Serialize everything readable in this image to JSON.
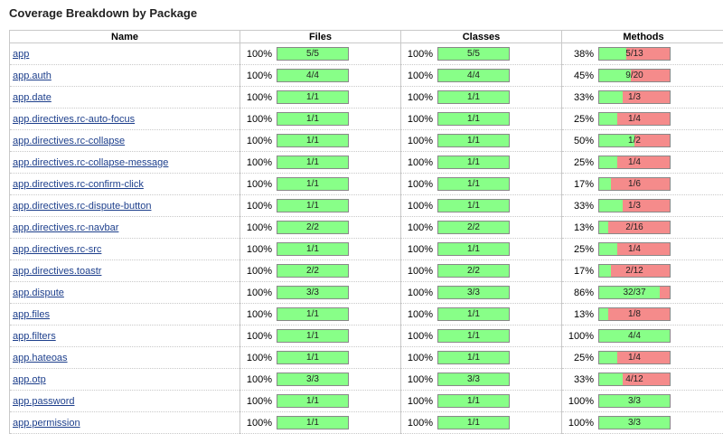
{
  "page": {
    "title": "Coverage Breakdown by Package"
  },
  "columns": {
    "name": "Name",
    "files": "Files",
    "classes": "Classes",
    "methods": "Methods"
  },
  "rows": [
    {
      "name": "app",
      "files": {
        "pct": "100%",
        "label": "5/5",
        "fill": 1
      },
      "classes": {
        "pct": "100%",
        "label": "5/5",
        "fill": 1
      },
      "methods": {
        "pct": "38%",
        "label": "5/13",
        "fill": 0.38
      }
    },
    {
      "name": "app.auth",
      "files": {
        "pct": "100%",
        "label": "4/4",
        "fill": 1
      },
      "classes": {
        "pct": "100%",
        "label": "4/4",
        "fill": 1
      },
      "methods": {
        "pct": "45%",
        "label": "9/20",
        "fill": 0.45
      }
    },
    {
      "name": "app.date",
      "files": {
        "pct": "100%",
        "label": "1/1",
        "fill": 1
      },
      "classes": {
        "pct": "100%",
        "label": "1/1",
        "fill": 1
      },
      "methods": {
        "pct": "33%",
        "label": "1/3",
        "fill": 0.33
      }
    },
    {
      "name": "app.directives.rc-auto-focus",
      "files": {
        "pct": "100%",
        "label": "1/1",
        "fill": 1
      },
      "classes": {
        "pct": "100%",
        "label": "1/1",
        "fill": 1
      },
      "methods": {
        "pct": "25%",
        "label": "1/4",
        "fill": 0.25
      }
    },
    {
      "name": "app.directives.rc-collapse",
      "files": {
        "pct": "100%",
        "label": "1/1",
        "fill": 1
      },
      "classes": {
        "pct": "100%",
        "label": "1/1",
        "fill": 1
      },
      "methods": {
        "pct": "50%",
        "label": "1/2",
        "fill": 0.5
      }
    },
    {
      "name": "app.directives.rc-collapse-message",
      "files": {
        "pct": "100%",
        "label": "1/1",
        "fill": 1
      },
      "classes": {
        "pct": "100%",
        "label": "1/1",
        "fill": 1
      },
      "methods": {
        "pct": "25%",
        "label": "1/4",
        "fill": 0.25
      }
    },
    {
      "name": "app.directives.rc-confirm-click",
      "files": {
        "pct": "100%",
        "label": "1/1",
        "fill": 1
      },
      "classes": {
        "pct": "100%",
        "label": "1/1",
        "fill": 1
      },
      "methods": {
        "pct": "17%",
        "label": "1/6",
        "fill": 0.17
      }
    },
    {
      "name": "app.directives.rc-dispute-button",
      "files": {
        "pct": "100%",
        "label": "1/1",
        "fill": 1
      },
      "classes": {
        "pct": "100%",
        "label": "1/1",
        "fill": 1
      },
      "methods": {
        "pct": "33%",
        "label": "1/3",
        "fill": 0.33
      }
    },
    {
      "name": "app.directives.rc-navbar",
      "files": {
        "pct": "100%",
        "label": "2/2",
        "fill": 1
      },
      "classes": {
        "pct": "100%",
        "label": "2/2",
        "fill": 1
      },
      "methods": {
        "pct": "13%",
        "label": "2/16",
        "fill": 0.13
      }
    },
    {
      "name": "app.directives.rc-src",
      "files": {
        "pct": "100%",
        "label": "1/1",
        "fill": 1
      },
      "classes": {
        "pct": "100%",
        "label": "1/1",
        "fill": 1
      },
      "methods": {
        "pct": "25%",
        "label": "1/4",
        "fill": 0.25
      }
    },
    {
      "name": "app.directives.toastr",
      "files": {
        "pct": "100%",
        "label": "2/2",
        "fill": 1
      },
      "classes": {
        "pct": "100%",
        "label": "2/2",
        "fill": 1
      },
      "methods": {
        "pct": "17%",
        "label": "2/12",
        "fill": 0.17
      }
    },
    {
      "name": "app.dispute",
      "files": {
        "pct": "100%",
        "label": "3/3",
        "fill": 1
      },
      "classes": {
        "pct": "100%",
        "label": "3/3",
        "fill": 1
      },
      "methods": {
        "pct": "86%",
        "label": "32/37",
        "fill": 0.86
      }
    },
    {
      "name": "app.files",
      "files": {
        "pct": "100%",
        "label": "1/1",
        "fill": 1
      },
      "classes": {
        "pct": "100%",
        "label": "1/1",
        "fill": 1
      },
      "methods": {
        "pct": "13%",
        "label": "1/8",
        "fill": 0.13
      }
    },
    {
      "name": "app.filters",
      "files": {
        "pct": "100%",
        "label": "1/1",
        "fill": 1
      },
      "classes": {
        "pct": "100%",
        "label": "1/1",
        "fill": 1
      },
      "methods": {
        "pct": "100%",
        "label": "4/4",
        "fill": 1
      }
    },
    {
      "name": "app.hateoas",
      "files": {
        "pct": "100%",
        "label": "1/1",
        "fill": 1
      },
      "classes": {
        "pct": "100%",
        "label": "1/1",
        "fill": 1
      },
      "methods": {
        "pct": "25%",
        "label": "1/4",
        "fill": 0.25
      }
    },
    {
      "name": "app.otp",
      "files": {
        "pct": "100%",
        "label": "3/3",
        "fill": 1
      },
      "classes": {
        "pct": "100%",
        "label": "3/3",
        "fill": 1
      },
      "methods": {
        "pct": "33%",
        "label": "4/12",
        "fill": 0.33
      }
    },
    {
      "name": "app.password",
      "files": {
        "pct": "100%",
        "label": "1/1",
        "fill": 1
      },
      "classes": {
        "pct": "100%",
        "label": "1/1",
        "fill": 1
      },
      "methods": {
        "pct": "100%",
        "label": "3/3",
        "fill": 1
      }
    },
    {
      "name": "app.permission",
      "files": {
        "pct": "100%",
        "label": "1/1",
        "fill": 1
      },
      "classes": {
        "pct": "100%",
        "label": "1/1",
        "fill": 1
      },
      "methods": {
        "pct": "100%",
        "label": "3/3",
        "fill": 1
      }
    }
  ],
  "colors": {
    "covered": "#88ff88",
    "uncovered": "#f58b8b",
    "link": "#1d3f8c",
    "grid": "#c9c9c9"
  }
}
